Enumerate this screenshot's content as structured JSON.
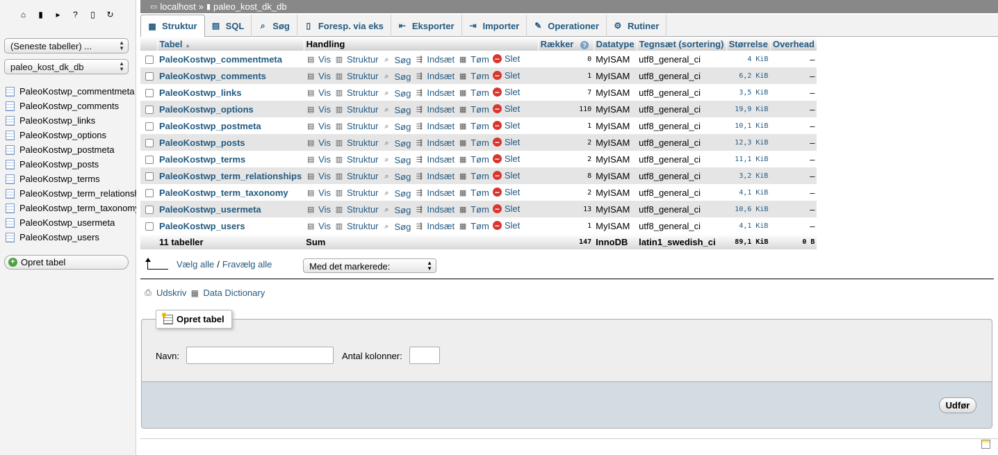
{
  "breadcrumb": {
    "server": "localhost",
    "separator": "»",
    "database": "paleo_kost_dk_db"
  },
  "sidebar": {
    "recent_select": "(Seneste tabeller) ...",
    "db_select": "paleo_kost_dk_db",
    "tables": [
      "PaleoKostwp_commentmeta",
      "PaleoKostwp_comments",
      "PaleoKostwp_links",
      "PaleoKostwp_options",
      "PaleoKostwp_postmeta",
      "PaleoKostwp_posts",
      "PaleoKostwp_terms",
      "PaleoKostwp_term_relationships",
      "PaleoKostwp_term_taxonomy",
      "PaleoKostwp_usermeta",
      "PaleoKostwp_users"
    ],
    "create_table": "Opret tabel"
  },
  "tabs": [
    "Struktur",
    "SQL",
    "Søg",
    "Foresp. via eks",
    "Eksporter",
    "Importer",
    "Operationer",
    "Rutiner"
  ],
  "table": {
    "headers": {
      "tabel": "Tabel",
      "handling": "Handling",
      "raekker": "Rækker",
      "datatype": "Datatype",
      "tegnsaet": "Tegnsæt (sortering)",
      "stoerrelse": "Størrelse",
      "overhead": "Overhead"
    },
    "actions": [
      "Vis",
      "Struktur",
      "Søg",
      "Indsæt",
      "Tøm",
      "Slet"
    ],
    "rows": [
      {
        "name": "PaleoKostwp_commentmeta",
        "rows": "0",
        "engine": "MyISAM",
        "collation": "utf8_general_ci",
        "size": "4 KiB",
        "overhead": "–"
      },
      {
        "name": "PaleoKostwp_comments",
        "rows": "1",
        "engine": "MyISAM",
        "collation": "utf8_general_ci",
        "size": "6,2 KiB",
        "overhead": "–"
      },
      {
        "name": "PaleoKostwp_links",
        "rows": "7",
        "engine": "MyISAM",
        "collation": "utf8_general_ci",
        "size": "3,5 KiB",
        "overhead": "–"
      },
      {
        "name": "PaleoKostwp_options",
        "rows": "110",
        "engine": "MyISAM",
        "collation": "utf8_general_ci",
        "size": "19,9 KiB",
        "overhead": "–"
      },
      {
        "name": "PaleoKostwp_postmeta",
        "rows": "1",
        "engine": "MyISAM",
        "collation": "utf8_general_ci",
        "size": "10,1 KiB",
        "overhead": "–"
      },
      {
        "name": "PaleoKostwp_posts",
        "rows": "2",
        "engine": "MyISAM",
        "collation": "utf8_general_ci",
        "size": "12,3 KiB",
        "overhead": "–"
      },
      {
        "name": "PaleoKostwp_terms",
        "rows": "2",
        "engine": "MyISAM",
        "collation": "utf8_general_ci",
        "size": "11,1 KiB",
        "overhead": "–"
      },
      {
        "name": "PaleoKostwp_term_relationships",
        "rows": "8",
        "engine": "MyISAM",
        "collation": "utf8_general_ci",
        "size": "3,2 KiB",
        "overhead": "–"
      },
      {
        "name": "PaleoKostwp_term_taxonomy",
        "rows": "2",
        "engine": "MyISAM",
        "collation": "utf8_general_ci",
        "size": "4,1 KiB",
        "overhead": "–"
      },
      {
        "name": "PaleoKostwp_usermeta",
        "rows": "13",
        "engine": "MyISAM",
        "collation": "utf8_general_ci",
        "size": "10,6 KiB",
        "overhead": "–"
      },
      {
        "name": "PaleoKostwp_users",
        "rows": "1",
        "engine": "MyISAM",
        "collation": "utf8_general_ci",
        "size": "4,1 KiB",
        "overhead": "–"
      }
    ],
    "footer": {
      "count": "11 tabeller",
      "sum": "Sum",
      "rows": "147",
      "engine": "InnoDB",
      "collation": "latin1_swedish_ci",
      "size": "89,1 KiB",
      "overhead": "0 B"
    }
  },
  "check_all": {
    "select": "Vælg alle",
    "separator": "/",
    "deselect": "Fravælg alle",
    "with_selected": "Med det markerede:"
  },
  "links": {
    "print": "Udskriv",
    "data_dictionary": "Data Dictionary"
  },
  "create_form": {
    "legend": "Opret tabel",
    "name_label": "Navn:",
    "name_value": "",
    "columns_label": "Antal kolonner:",
    "columns_value": "",
    "submit": "Udfør"
  },
  "colors": {
    "link": "#235a81",
    "breadcrumb_bg": "#888888",
    "row_alt": "#e5e5e5",
    "form_bottom": "#d3dce3"
  }
}
